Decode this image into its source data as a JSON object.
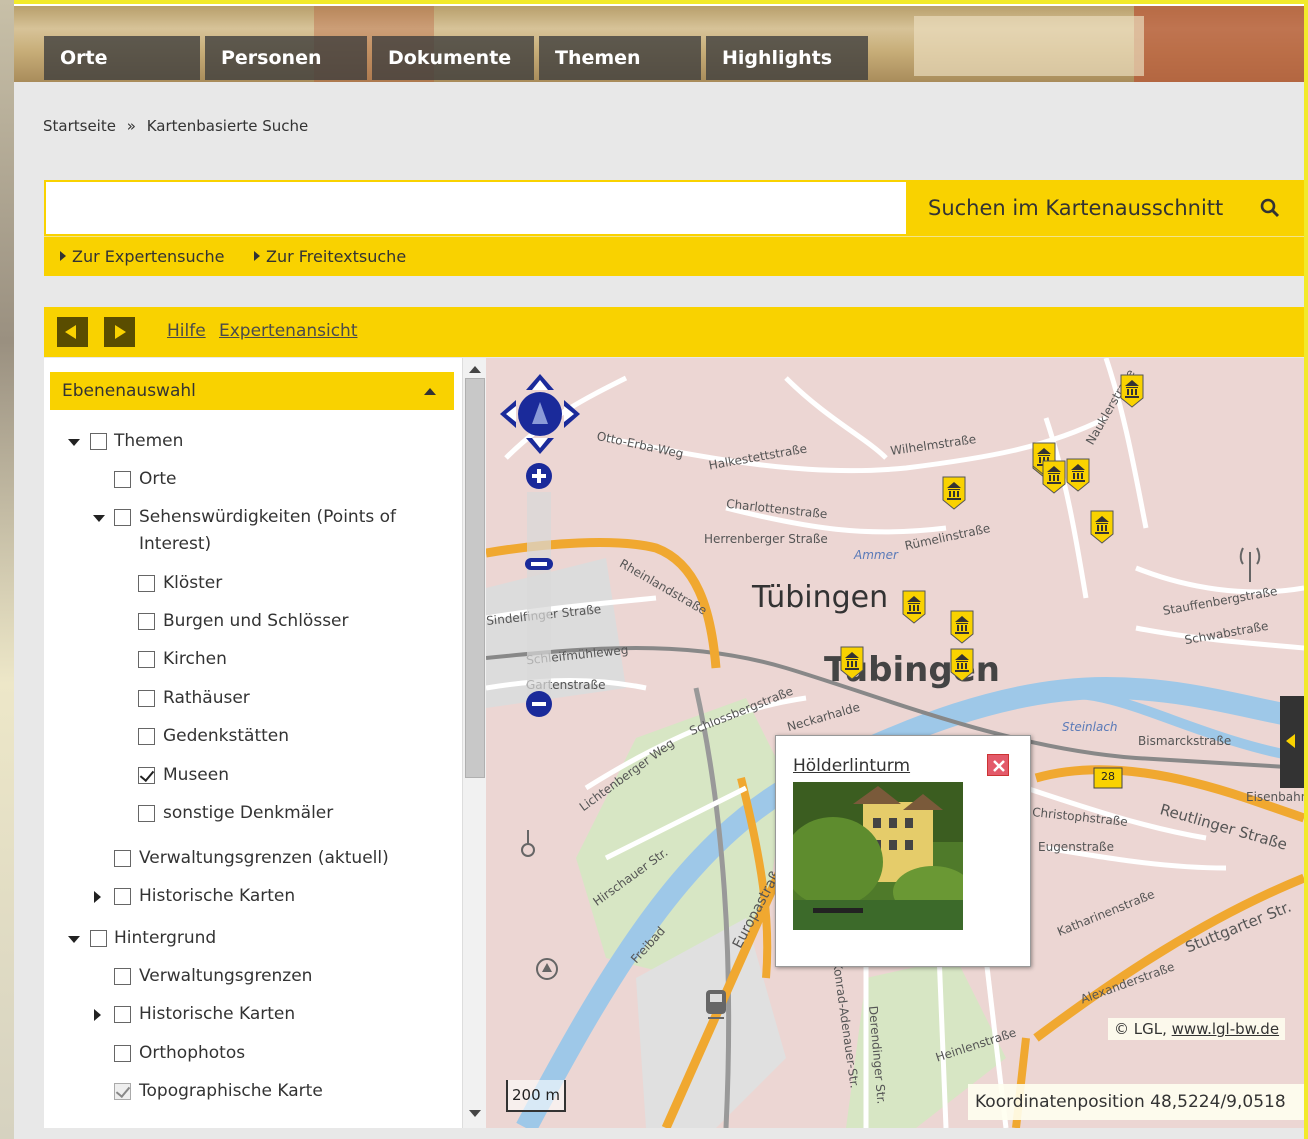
{
  "nav": {
    "tabs": [
      {
        "label": "Orte"
      },
      {
        "label": "Personen"
      },
      {
        "label": "Dokumente"
      },
      {
        "label": "Themen"
      },
      {
        "label": "Highlights"
      }
    ]
  },
  "breadcrumb": {
    "home": "Startseite",
    "separator": "»",
    "current": "Kartenbasierte Suche"
  },
  "search": {
    "value": "",
    "button_label": "Suchen im Kartenausschnitt",
    "expert_link": "Zur Expertensuche",
    "freetext_link": "Zur Freitextsuche"
  },
  "toolbar": {
    "help_link": "Hilfe",
    "expert_view_link": "Expertenansicht"
  },
  "layers": {
    "header": "Ebenenauswahl",
    "themen": {
      "label": "Themen",
      "checked": false
    },
    "orte": {
      "label": "Orte",
      "checked": false
    },
    "poi": {
      "label_line1": "Sehenswürdigkeiten (Points of",
      "label_line2": "Interest)",
      "checked": false
    },
    "kloester": {
      "label": "Klöster",
      "checked": false
    },
    "burgen": {
      "label": "Burgen und Schlösser",
      "checked": false
    },
    "kirchen": {
      "label": "Kirchen",
      "checked": false
    },
    "rathaeuser": {
      "label": "Rathäuser",
      "checked": false
    },
    "gedenkstaetten": {
      "label": "Gedenkstätten",
      "checked": false
    },
    "museen": {
      "label": "Museen",
      "checked": true
    },
    "sonstige": {
      "label": "sonstige Denkmäler",
      "checked": false
    },
    "verwaltung_aktuell": {
      "label": "Verwaltungsgrenzen (aktuell)",
      "checked": false
    },
    "hist_karten_1": {
      "label": "Historische Karten",
      "checked": false
    },
    "hintergrund": {
      "label": "Hintergrund",
      "checked": false
    },
    "verwaltung": {
      "label": "Verwaltungsgrenzen",
      "checked": false
    },
    "hist_karten_2": {
      "label": "Historische Karten",
      "checked": false
    },
    "orthophotos": {
      "label": "Orthophotos",
      "checked": false
    },
    "topo": {
      "label": "Topographische Karte",
      "checked": true
    }
  },
  "map": {
    "city_label_1": "Tübingen",
    "city_label_2": "Tübingen",
    "street_labels": {
      "otto_erba": "Otto-Erba-Weg",
      "haldenstr": "Halkestettstraße",
      "wilhelm": "Wilhelmstraße",
      "nauklerstr": "Nauklerstraße",
      "charlotten": "Charlottenstraße",
      "herrenberger": "Herrenberger Straße",
      "ammer": "Ammer",
      "ruemelin": "Rümelinstraße",
      "rheinland": "Rheinlandstraße",
      "stauffenberg": "Stauffenbergstraße",
      "schwabstr": "Schwabstraße",
      "schleifmuehle": "Schleifmühleweg",
      "neckarhalde": "Neckarhalde",
      "steinlach": "Steinlach",
      "bismarck": "Bismarckstraße",
      "reutlinger": "Reutlinger Straße",
      "stuttgarter": "Stuttgarter Str.",
      "christoph": "Christophstraße",
      "eugen": "Eugenstraße",
      "katharinen": "Katharinenstraße",
      "alexander": "Alexanderstraße",
      "europastr": "Europastraße",
      "freibad": "Freibad",
      "lichtenberger": "Lichtenberger Weg",
      "hirschauer": "Hirschauer Str.",
      "schwenkstr": "Schlossbergstraße",
      "b28": "28",
      "eisenbahn": "Eisenbahn",
      "konrad": "Konrad-Adenauer-Str.",
      "derendinger": "Derendinger Str.",
      "heinlen": "Heinlenstraße",
      "sand": "Sindelfinger Straße",
      "gartenstr": "Gartenstraße"
    },
    "popup": {
      "title": "Hölderlinturm"
    },
    "copyright_prefix": "© LGL, ",
    "copyright_link": "www.lgl-bw.de",
    "scale": "200 m",
    "coords": "Koordinatenposition 48,5224/9,0518",
    "colors": {
      "accent": "#f9d200",
      "road_major": "#f0a830",
      "river": "#9ec8e8",
      "map_bg": "#ecd6d3",
      "nav_ctrl": "#1a2a9a"
    }
  }
}
